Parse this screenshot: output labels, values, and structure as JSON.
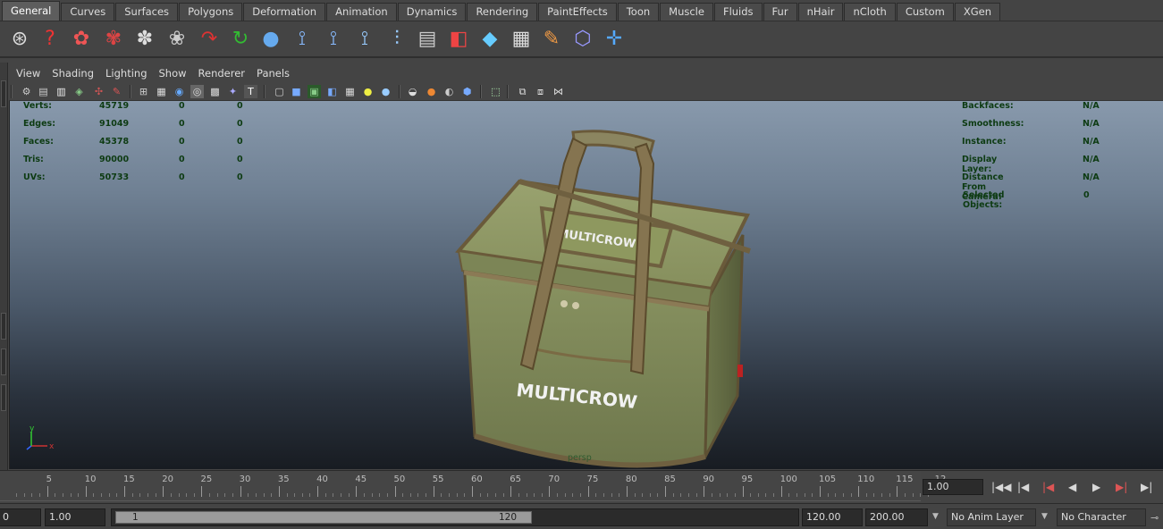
{
  "shelf_tabs": [
    "General",
    "Curves",
    "Surfaces",
    "Polygons",
    "Deformation",
    "Animation",
    "Dynamics",
    "Rendering",
    "PaintEffects",
    "Toon",
    "Muscle",
    "Fluids",
    "Fur",
    "nHair",
    "nCloth",
    "Custom",
    "XGen"
  ],
  "active_tab": "General",
  "shelf_icons": [
    "film-reel-magnifier-icon",
    "help-question-icon",
    "render-camera-icon",
    "ipr-render-icon",
    "render-settings-icon",
    "hypershade-icon",
    "lasso-arrow-icon",
    "green-arrow-icon",
    "sphere-trash-icon",
    "bounding-hierarchy-icon",
    "hierarchy-icon",
    "joint-chain-icon",
    "joint-pair-icon",
    "attribute-editor-icon",
    "red-node-icon",
    "cube-to-sphere-icon",
    "uv-checker-icon",
    "paint-brush-icon",
    "manipulator-cube-icon",
    "xyz-axes-icon"
  ],
  "panel_menus": [
    "View",
    "Shading",
    "Lighting",
    "Show",
    "Renderer",
    "Panels"
  ],
  "hud_left": {
    "rows": [
      {
        "label": "Verts:",
        "v1": "45719",
        "v2": "0",
        "v3": "0"
      },
      {
        "label": "Edges:",
        "v1": "91049",
        "v2": "0",
        "v3": "0"
      },
      {
        "label": "Faces:",
        "v1": "45378",
        "v2": "0",
        "v3": "0"
      },
      {
        "label": "Tris:",
        "v1": "90000",
        "v2": "0",
        "v3": "0"
      },
      {
        "label": "UVs:",
        "v1": "50733",
        "v2": "0",
        "v3": "0"
      }
    ]
  },
  "hud_right": {
    "rows": [
      {
        "label": "Backfaces:",
        "value": "N/A"
      },
      {
        "label": "Smoothness:",
        "value": "N/A"
      },
      {
        "label": "Instance:",
        "value": "N/A"
      },
      {
        "label": "Display Layer:",
        "value": "N/A"
      },
      {
        "label": "Distance From Camera:",
        "value": "N/A"
      },
      {
        "label": "Selected Objects:",
        "value": "0"
      }
    ]
  },
  "viewport": {
    "camera_label": "persp",
    "model_brand_text": "MULTICROW",
    "axis_x": "x",
    "axis_y": "y"
  },
  "timeline": {
    "ticks": [
      "5",
      "10",
      "15",
      "20",
      "25",
      "30",
      "35",
      "40",
      "45",
      "50",
      "55",
      "60",
      "65",
      "70",
      "75",
      "80",
      "85",
      "90",
      "95",
      "100",
      "105",
      "110",
      "115",
      "12"
    ],
    "current_frame": "1.00"
  },
  "range": {
    "start_time_partial": "0",
    "playback_start": "1.00",
    "thumb_start": "1",
    "thumb_end": "120",
    "playback_end": "120.00",
    "end_time": "200.00",
    "anim_layer": "No Anim Layer",
    "character_set": "No Character Set"
  },
  "colors": {
    "hud_text": "#0d3b12",
    "bag_green": "#7d8757",
    "strap_brown": "#7a6a44"
  }
}
